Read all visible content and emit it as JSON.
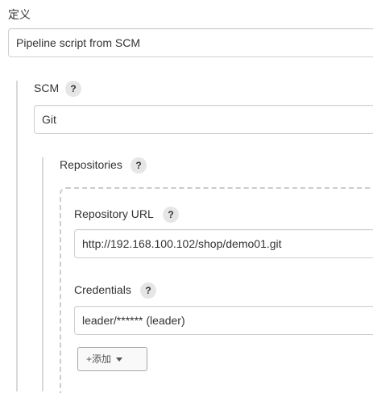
{
  "definition": {
    "label": "定义",
    "selected": "Pipeline script from SCM"
  },
  "scm": {
    "label": "SCM",
    "help": "?",
    "selected": "Git"
  },
  "repositories": {
    "label": "Repositories",
    "help": "?",
    "repository_url": {
      "label": "Repository URL",
      "help": "?",
      "value": "http://192.168.100.102/shop/demo01.git"
    },
    "credentials": {
      "label": "Credentials",
      "help": "?",
      "selected": "leader/****** (leader)",
      "add_button": {
        "plus": "+",
        "label": "添加"
      }
    }
  },
  "icons": [
    "help-icon",
    "plus-icon",
    "caret-down-icon"
  ]
}
